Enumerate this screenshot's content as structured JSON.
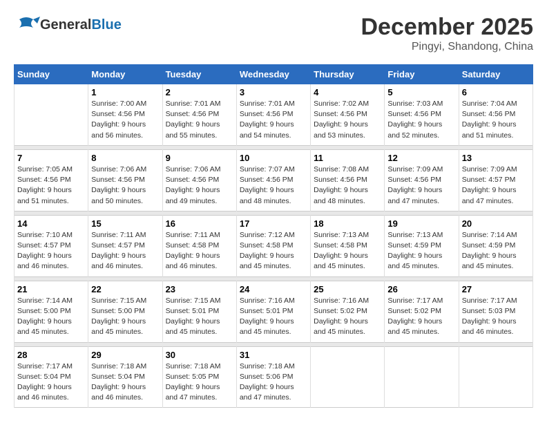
{
  "header": {
    "logo_general": "General",
    "logo_blue": "Blue",
    "title": "December 2025",
    "location": "Pingyi, Shandong, China"
  },
  "calendar": {
    "days_of_week": [
      "Sunday",
      "Monday",
      "Tuesday",
      "Wednesday",
      "Thursday",
      "Friday",
      "Saturday"
    ],
    "weeks": [
      [
        {
          "day": "",
          "info": ""
        },
        {
          "day": "1",
          "info": "Sunrise: 7:00 AM\nSunset: 4:56 PM\nDaylight: 9 hours\nand 56 minutes."
        },
        {
          "day": "2",
          "info": "Sunrise: 7:01 AM\nSunset: 4:56 PM\nDaylight: 9 hours\nand 55 minutes."
        },
        {
          "day": "3",
          "info": "Sunrise: 7:01 AM\nSunset: 4:56 PM\nDaylight: 9 hours\nand 54 minutes."
        },
        {
          "day": "4",
          "info": "Sunrise: 7:02 AM\nSunset: 4:56 PM\nDaylight: 9 hours\nand 53 minutes."
        },
        {
          "day": "5",
          "info": "Sunrise: 7:03 AM\nSunset: 4:56 PM\nDaylight: 9 hours\nand 52 minutes."
        },
        {
          "day": "6",
          "info": "Sunrise: 7:04 AM\nSunset: 4:56 PM\nDaylight: 9 hours\nand 51 minutes."
        }
      ],
      [
        {
          "day": "7",
          "info": "Sunrise: 7:05 AM\nSunset: 4:56 PM\nDaylight: 9 hours\nand 51 minutes."
        },
        {
          "day": "8",
          "info": "Sunrise: 7:06 AM\nSunset: 4:56 PM\nDaylight: 9 hours\nand 50 minutes."
        },
        {
          "day": "9",
          "info": "Sunrise: 7:06 AM\nSunset: 4:56 PM\nDaylight: 9 hours\nand 49 minutes."
        },
        {
          "day": "10",
          "info": "Sunrise: 7:07 AM\nSunset: 4:56 PM\nDaylight: 9 hours\nand 48 minutes."
        },
        {
          "day": "11",
          "info": "Sunrise: 7:08 AM\nSunset: 4:56 PM\nDaylight: 9 hours\nand 48 minutes."
        },
        {
          "day": "12",
          "info": "Sunrise: 7:09 AM\nSunset: 4:56 PM\nDaylight: 9 hours\nand 47 minutes."
        },
        {
          "day": "13",
          "info": "Sunrise: 7:09 AM\nSunset: 4:57 PM\nDaylight: 9 hours\nand 47 minutes."
        }
      ],
      [
        {
          "day": "14",
          "info": "Sunrise: 7:10 AM\nSunset: 4:57 PM\nDaylight: 9 hours\nand 46 minutes."
        },
        {
          "day": "15",
          "info": "Sunrise: 7:11 AM\nSunset: 4:57 PM\nDaylight: 9 hours\nand 46 minutes."
        },
        {
          "day": "16",
          "info": "Sunrise: 7:11 AM\nSunset: 4:58 PM\nDaylight: 9 hours\nand 46 minutes."
        },
        {
          "day": "17",
          "info": "Sunrise: 7:12 AM\nSunset: 4:58 PM\nDaylight: 9 hours\nand 45 minutes."
        },
        {
          "day": "18",
          "info": "Sunrise: 7:13 AM\nSunset: 4:58 PM\nDaylight: 9 hours\nand 45 minutes."
        },
        {
          "day": "19",
          "info": "Sunrise: 7:13 AM\nSunset: 4:59 PM\nDaylight: 9 hours\nand 45 minutes."
        },
        {
          "day": "20",
          "info": "Sunrise: 7:14 AM\nSunset: 4:59 PM\nDaylight: 9 hours\nand 45 minutes."
        }
      ],
      [
        {
          "day": "21",
          "info": "Sunrise: 7:14 AM\nSunset: 5:00 PM\nDaylight: 9 hours\nand 45 minutes."
        },
        {
          "day": "22",
          "info": "Sunrise: 7:15 AM\nSunset: 5:00 PM\nDaylight: 9 hours\nand 45 minutes."
        },
        {
          "day": "23",
          "info": "Sunrise: 7:15 AM\nSunset: 5:01 PM\nDaylight: 9 hours\nand 45 minutes."
        },
        {
          "day": "24",
          "info": "Sunrise: 7:16 AM\nSunset: 5:01 PM\nDaylight: 9 hours\nand 45 minutes."
        },
        {
          "day": "25",
          "info": "Sunrise: 7:16 AM\nSunset: 5:02 PM\nDaylight: 9 hours\nand 45 minutes."
        },
        {
          "day": "26",
          "info": "Sunrise: 7:17 AM\nSunset: 5:02 PM\nDaylight: 9 hours\nand 45 minutes."
        },
        {
          "day": "27",
          "info": "Sunrise: 7:17 AM\nSunset: 5:03 PM\nDaylight: 9 hours\nand 46 minutes."
        }
      ],
      [
        {
          "day": "28",
          "info": "Sunrise: 7:17 AM\nSunset: 5:04 PM\nDaylight: 9 hours\nand 46 minutes."
        },
        {
          "day": "29",
          "info": "Sunrise: 7:18 AM\nSunset: 5:04 PM\nDaylight: 9 hours\nand 46 minutes."
        },
        {
          "day": "30",
          "info": "Sunrise: 7:18 AM\nSunset: 5:05 PM\nDaylight: 9 hours\nand 47 minutes."
        },
        {
          "day": "31",
          "info": "Sunrise: 7:18 AM\nSunset: 5:06 PM\nDaylight: 9 hours\nand 47 minutes."
        },
        {
          "day": "",
          "info": ""
        },
        {
          "day": "",
          "info": ""
        },
        {
          "day": "",
          "info": ""
        }
      ]
    ]
  }
}
